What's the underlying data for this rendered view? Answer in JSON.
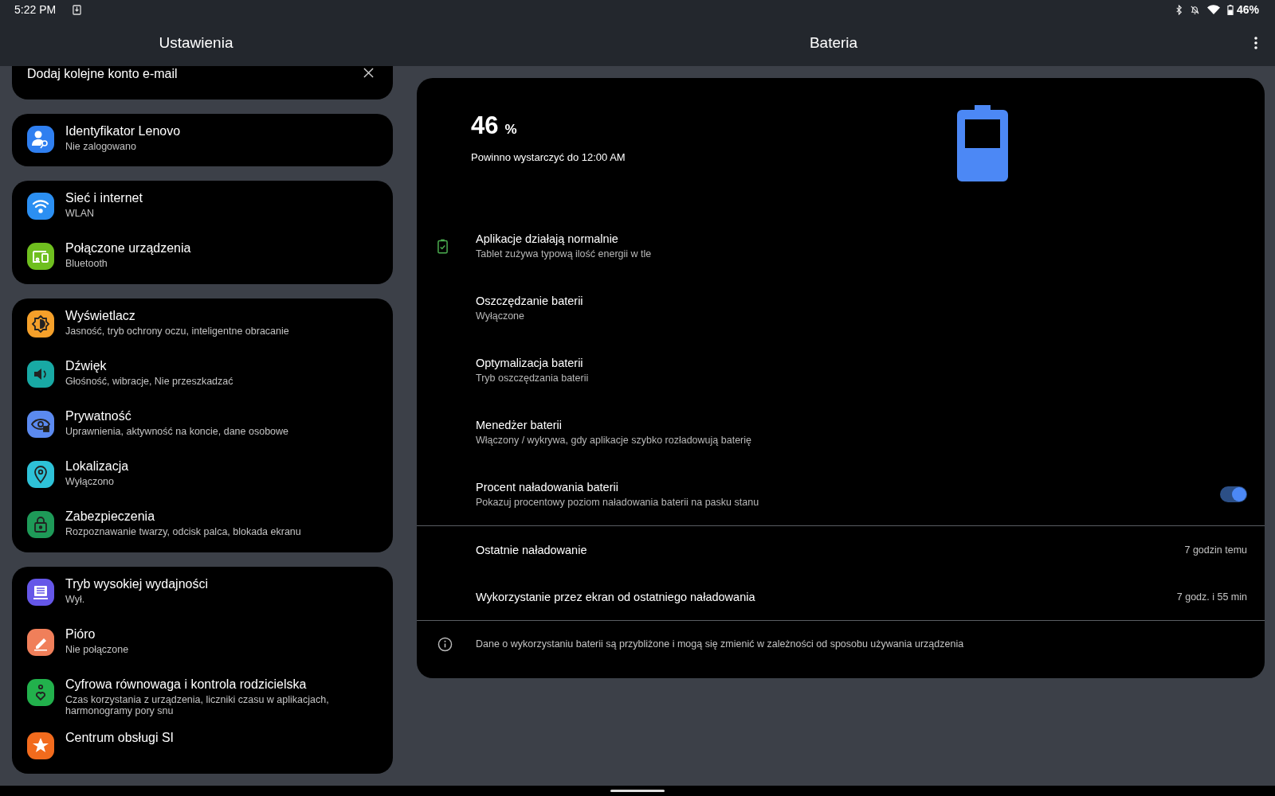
{
  "status_bar": {
    "time": "5:22 PM",
    "battery": "46%"
  },
  "settings_pane": {
    "title": "Ustawienia",
    "groups": [
      {
        "items": [
          {
            "title": "Dodaj kolejne konto e-mail",
            "kind": "banner"
          }
        ]
      },
      {
        "items": [
          {
            "title": "Identyfikator Lenovo",
            "subtitle": "Nie zalogowano",
            "color": "#2f7ff0",
            "kind": "setting"
          }
        ]
      },
      {
        "items": [
          {
            "title": "Sieć i internet",
            "subtitle": "WLAN",
            "color": "#2b8ff2",
            "kind": "setting"
          },
          {
            "title": "Połączone urządzenia",
            "subtitle": "Bluetooth",
            "color": "#6fbf1f",
            "kind": "setting"
          }
        ]
      },
      {
        "items": [
          {
            "title": "Wyświetlacz",
            "subtitle": "Jasność, tryb ochrony oczu, inteligentne obracanie",
            "color": "#f5a02a",
            "kind": "setting"
          },
          {
            "title": "Dźwięk",
            "subtitle": "Głośność, wibracje, Nie przeszkadzać",
            "color": "#18a9a4",
            "kind": "setting"
          },
          {
            "title": "Prywatność",
            "subtitle": "Uprawnienia, aktywność na koncie, dane osobowe",
            "color": "#5b8af0",
            "kind": "setting"
          },
          {
            "title": "Lokalizacja",
            "subtitle": "Wyłączono",
            "color": "#2ec2d8",
            "kind": "setting"
          },
          {
            "title": "Zabezpieczenia",
            "subtitle": "Rozpoznawanie twarzy, odcisk palca, blokada ekranu",
            "color": "#1e9a58",
            "kind": "setting"
          }
        ]
      },
      {
        "items": [
          {
            "title": "Tryb wysokiej wydajności",
            "subtitle": "Wył.",
            "color": "#6557e8",
            "kind": "setting"
          },
          {
            "title": "Pióro",
            "subtitle": "Nie połączone",
            "color": "#f07f5a",
            "kind": "setting"
          },
          {
            "title": "Cyfrowa równowaga i kontrola rodzicielska",
            "subtitle": "Czas korzystania z urządzenia, liczniki czasu w aplikacjach, harmonogramy pory snu",
            "color": "#22b14c",
            "kind": "setting"
          },
          {
            "title": "Centrum obsługi SI",
            "color": "#f26b1d",
            "kind": "setting"
          }
        ]
      }
    ]
  },
  "battery_pane": {
    "title": "Bateria",
    "percent": "46",
    "percent_unit": "%",
    "estimate": "Powinno wystarczyć do 12:00 AM",
    "rows": [
      {
        "kind": "status",
        "title": "Aplikacje działają normalnie",
        "subtitle": "Tablet zużywa typową ilość energii w tle"
      },
      {
        "kind": "link",
        "title": "Oszczędzanie baterii",
        "subtitle": "Wyłączone"
      },
      {
        "kind": "link",
        "title": "Optymalizacja baterii",
        "subtitle": "Tryb oszczędzania baterii"
      },
      {
        "kind": "link",
        "title": "Menedżer baterii",
        "subtitle": "Włączony / wykrywa, gdy aplikacje szybko rozładowują baterię"
      },
      {
        "kind": "toggle",
        "title": "Procent naładowania baterii",
        "subtitle": "Pokazuj procentowy poziom naładowania baterii na pasku stanu",
        "on": true
      },
      {
        "kind": "stat",
        "title": "Ostatnie naładowanie",
        "value": "7 godzin temu"
      },
      {
        "kind": "stat",
        "title": "Wykorzystanie przez ekran od ostatniego naładowania",
        "value": "7 godz. i 55 min"
      },
      {
        "kind": "info",
        "title": "Dane o wykorzystaniu baterii są przybliżone i mogą się zmienić w zależności od sposobu używania urządzenia"
      }
    ]
  }
}
